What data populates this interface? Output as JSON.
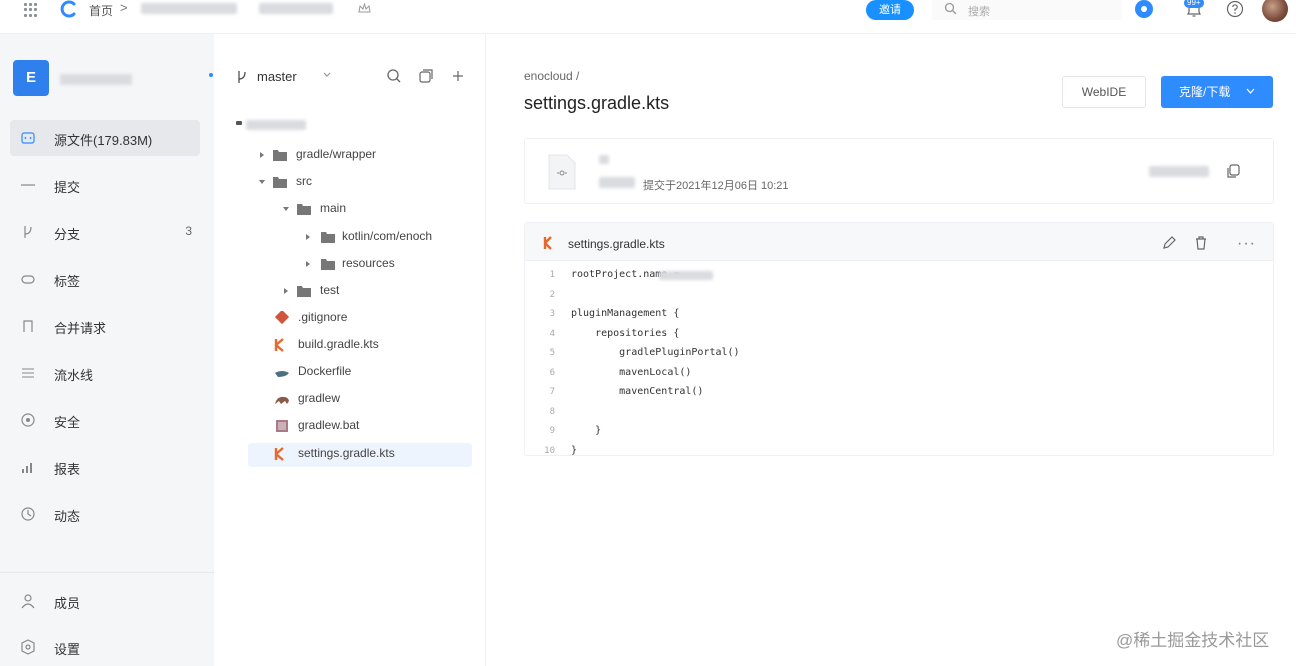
{
  "topbar": {
    "home_label": "首页",
    "sep": ">",
    "pill_label": "邀请",
    "search_placeholder": "搜索",
    "notification_badge": "99+"
  },
  "sidebar": {
    "project_initial": "E",
    "items": [
      {
        "label": "源文件(179.83M)",
        "icon": "code-icon",
        "active": true,
        "count": ""
      },
      {
        "label": "提交",
        "icon": "commit-icon",
        "active": false,
        "count": ""
      },
      {
        "label": "分支",
        "icon": "branch-icon",
        "active": false,
        "count": "3"
      },
      {
        "label": "标签",
        "icon": "tag-icon",
        "active": false,
        "count": ""
      },
      {
        "label": "合并请求",
        "icon": "merge-request-icon",
        "active": false,
        "count": ""
      },
      {
        "label": "流水线",
        "icon": "pipeline-icon",
        "active": false,
        "count": ""
      },
      {
        "label": "安全",
        "icon": "shield-icon",
        "active": false,
        "count": ""
      },
      {
        "label": "报表",
        "icon": "chart-icon",
        "active": false,
        "count": ""
      },
      {
        "label": "动态",
        "icon": "activity-icon",
        "active": false,
        "count": ""
      }
    ],
    "bottom": [
      {
        "label": "成员",
        "icon": "member-icon"
      },
      {
        "label": "设置",
        "icon": "settings-icon"
      }
    ]
  },
  "tree": {
    "branch": "master",
    "items": [
      {
        "name": "gradle/wrapper",
        "type": "folder",
        "arrow": "right"
      },
      {
        "name": "src",
        "type": "folder",
        "arrow": "down"
      },
      {
        "name": "main",
        "type": "folder",
        "arrow": "down"
      },
      {
        "name": "kotlin/com/enoch",
        "type": "folder",
        "arrow": "right"
      },
      {
        "name": "resources",
        "type": "folder",
        "arrow": "right"
      },
      {
        "name": "test",
        "type": "folder",
        "arrow": "right"
      },
      {
        "name": ".gitignore",
        "type": "git",
        "arrow": ""
      },
      {
        "name": "build.gradle.kts",
        "type": "kotlin",
        "arrow": ""
      },
      {
        "name": "Dockerfile",
        "type": "docker",
        "arrow": ""
      },
      {
        "name": "gradlew",
        "type": "gradle",
        "arrow": ""
      },
      {
        "name": "gradlew.bat",
        "type": "bat",
        "arrow": ""
      },
      {
        "name": "settings.gradle.kts",
        "type": "kotlin",
        "arrow": "",
        "active": true
      }
    ]
  },
  "main": {
    "breadcrumb": "enocloud  /",
    "file_title": "settings.gradle.kts",
    "webide_label": "WebIDE",
    "clone_label": "克隆/下载",
    "commit_text": "提交于2021年12月06日 10:21",
    "code_filename": "settings.gradle.kts",
    "code_lines": [
      {
        "n": "1",
        "code": "rootProject.name = "
      },
      {
        "n": "2",
        "code": ""
      },
      {
        "n": "3",
        "code": "pluginManagement {"
      },
      {
        "n": "4",
        "code": "    repositories {"
      },
      {
        "n": "5",
        "code": "        gradlePluginPortal()"
      },
      {
        "n": "6",
        "code": "        mavenLocal()"
      },
      {
        "n": "7",
        "code": "        mavenCentral()"
      },
      {
        "n": "8",
        "code": ""
      },
      {
        "n": "9",
        "code": "    }"
      },
      {
        "n": "10",
        "code": "}"
      }
    ]
  },
  "watermark": "@稀土掘金技术社区",
  "colors": {
    "accent": "#2f8cff",
    "kotlin": "#e8692f",
    "sidebar_bg": "#f5f6f8"
  }
}
